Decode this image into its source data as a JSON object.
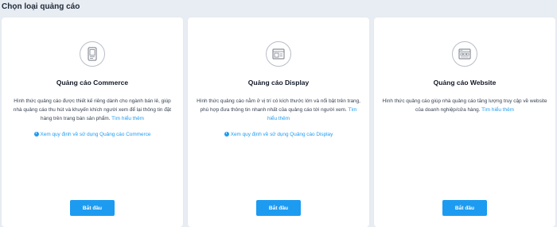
{
  "page": {
    "title": "Chọn loại quảng cáo"
  },
  "cards": [
    {
      "title": "Quảng cáo Commerce",
      "description": "Hình thức quảng cáo được thiết kế riêng dành cho ngành bán lẻ, giúp nhà quảng cáo thu hút và khuyến khích người xem để lại thông tin đặt hàng trên trang bán sản phẩm.",
      "learn_more": "Tìm hiểu thêm",
      "policy_link": "Xem quy định về sử dụng Quảng cáo Commerce",
      "button_label": "Bắt đầu",
      "icon": "mobile-commerce-icon"
    },
    {
      "title": "Quảng cáo Display",
      "description": "Hình thức quảng cáo nằm ở vị trí có kích thước lớn và nổi bật trên trang, phù hợp đưa thông tin nhanh nhất của quảng cáo tới người xem.",
      "learn_more": "Tìm hiểu thêm",
      "policy_link": "Xem quy định về sử dụng Quảng cáo Display",
      "button_label": "Bắt đầu",
      "icon": "display-ad-icon"
    },
    {
      "title": "Quảng cáo Website",
      "description": "Hình thức quảng cáo giúp nhà quảng cáo tăng lượng truy cập về website của doanh nghiệp/cửa hàng.",
      "learn_more": "Tìm hiểu thêm",
      "button_label": "Bắt đầu",
      "icon": "website-icon"
    }
  ],
  "colors": {
    "background": "#e8edf3",
    "accent": "#1d9bf0",
    "card": "#ffffff"
  }
}
